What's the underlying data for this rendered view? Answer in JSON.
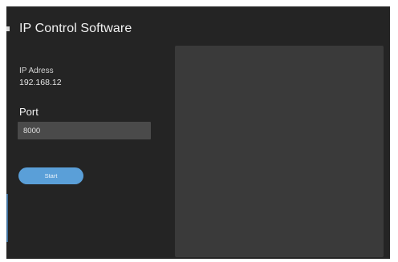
{
  "app": {
    "title": "IP Control Software"
  },
  "connection": {
    "ip_label": "IP Adress",
    "ip_value": "192.168.12",
    "port_label": "Port",
    "port_value": "8000"
  },
  "actions": {
    "start_label": "Start"
  },
  "colors": {
    "window_background": "#242424",
    "panel_background": "#3a3a3a",
    "input_background": "#4a4a4a",
    "accent": "#5a9fd8"
  }
}
